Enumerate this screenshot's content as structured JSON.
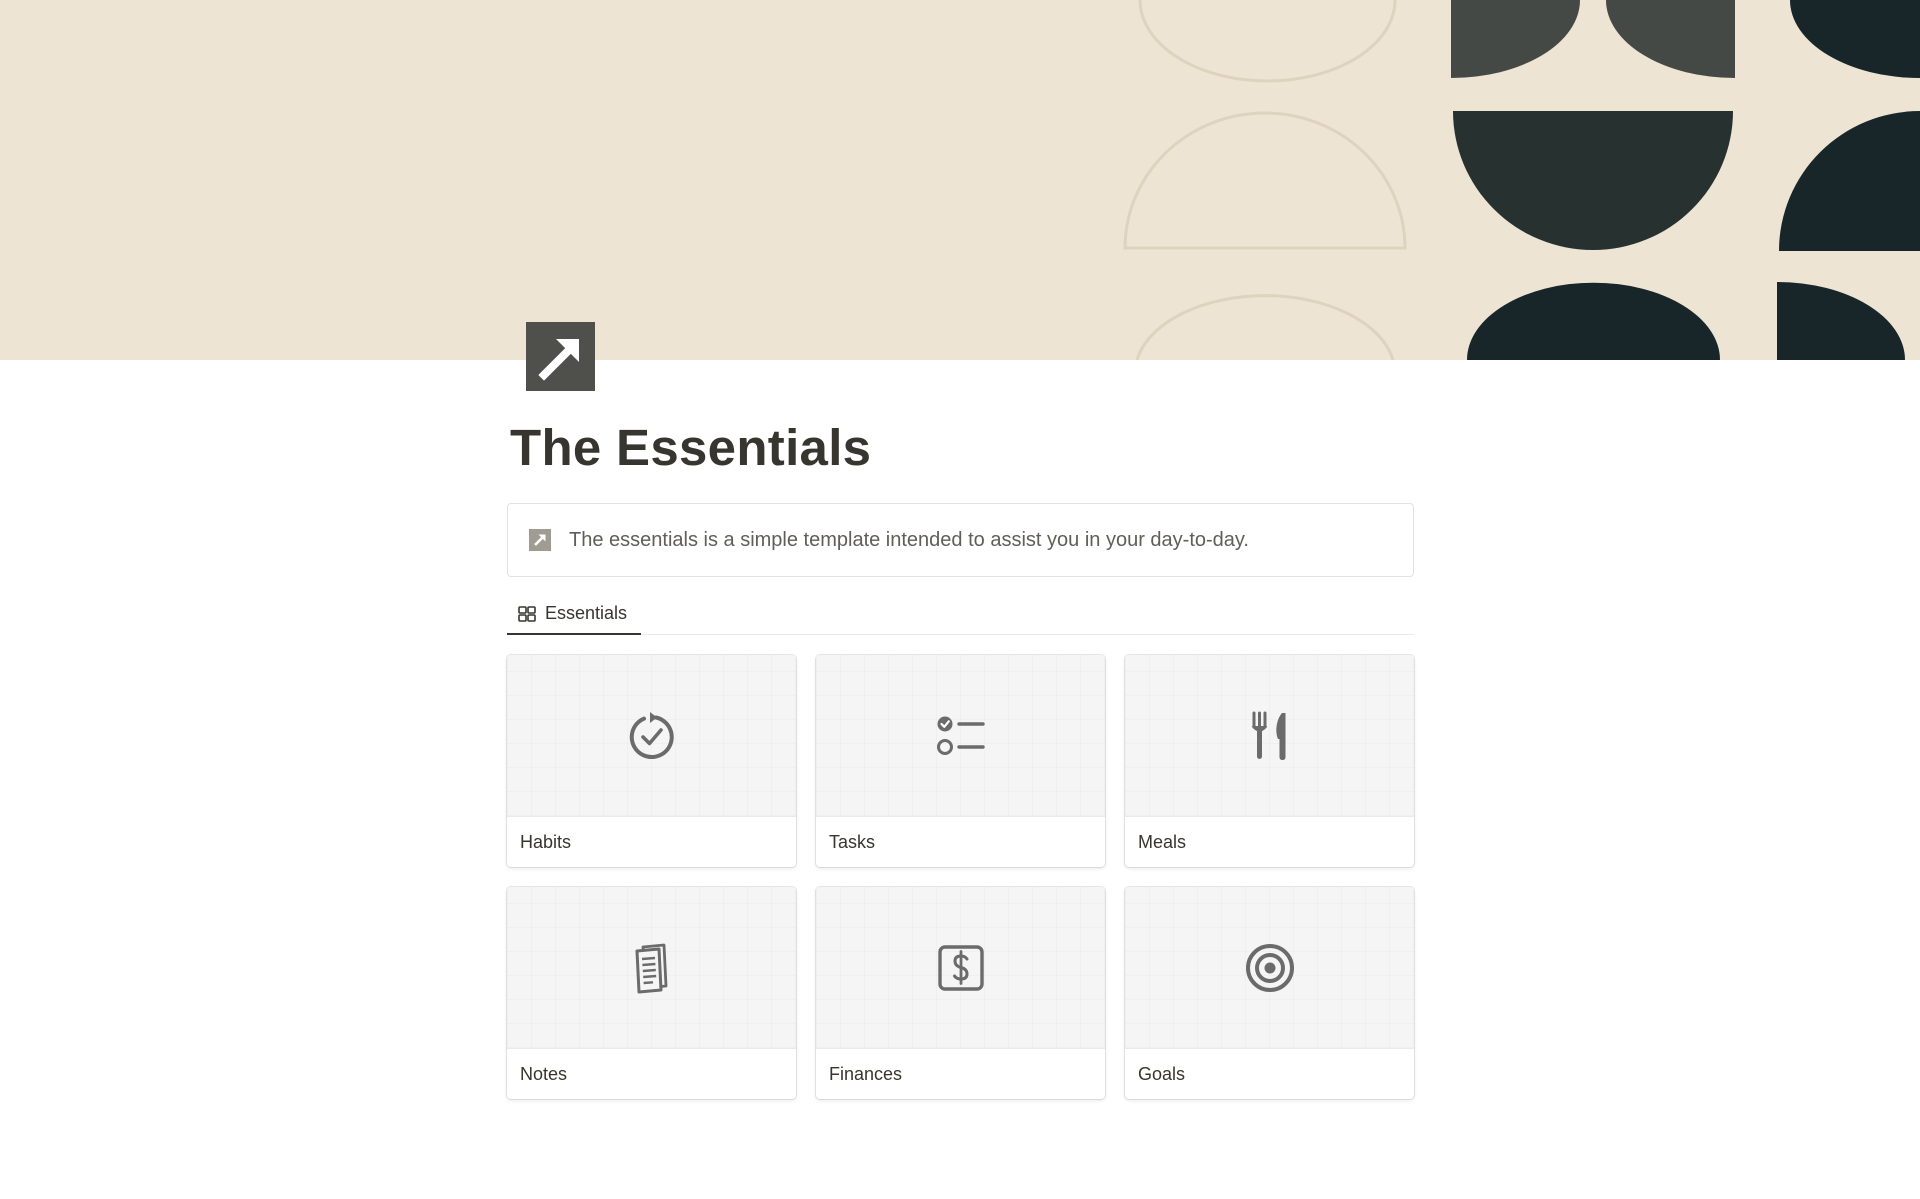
{
  "page": {
    "title": "The Essentials",
    "icon": "north-east-arrow-icon"
  },
  "cover": {
    "background": "#ede4d3",
    "shape_dark": "#1e2a27",
    "shape_outline": "#ddd3bf"
  },
  "callout": {
    "icon": "north-east-arrow-icon",
    "text": "The essentials is a simple template intended to assist you in your day-to-day."
  },
  "views": {
    "tabs": [
      {
        "label": "Essentials",
        "icon": "gallery-grid-icon",
        "active": true
      }
    ]
  },
  "gallery": {
    "cards": [
      {
        "title": "Habits",
        "icon": "circular-check-icon"
      },
      {
        "title": "Tasks",
        "icon": "checklist-icon"
      },
      {
        "title": "Meals",
        "icon": "fork-knife-icon"
      },
      {
        "title": "Notes",
        "icon": "document-icon"
      },
      {
        "title": "Finances",
        "icon": "dollar-box-icon"
      },
      {
        "title": "Goals",
        "icon": "target-icon"
      }
    ]
  },
  "colors": {
    "text": "#37352f",
    "muted_text": "#5f5e5b",
    "icon_gray": "#6b6b6b",
    "page_icon_bg": "#4f4f4b"
  }
}
